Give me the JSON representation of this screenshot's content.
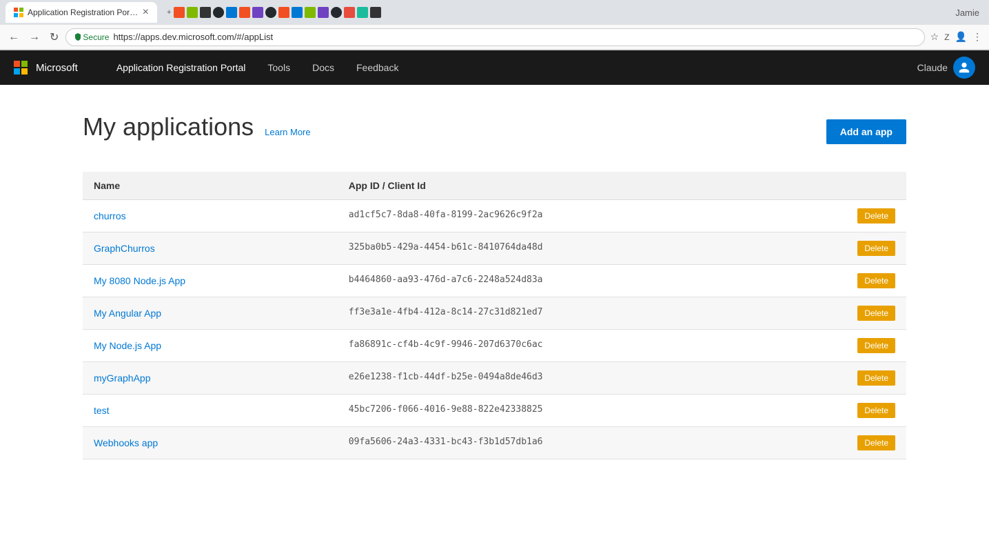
{
  "browser": {
    "tab": {
      "title": "Application Registration Portal",
      "close_icon": "×"
    },
    "address": {
      "secure_label": "Secure",
      "url": "https://apps.dev.microsoft.com/#/appList"
    },
    "user": "Jamie"
  },
  "header": {
    "brand": "Microsoft",
    "portal_title": "Application Registration Portal",
    "nav_items": [
      {
        "label": "Tools"
      },
      {
        "label": "Docs"
      },
      {
        "label": "Feedback"
      }
    ],
    "user_name": "Claude"
  },
  "page": {
    "title": "My applications",
    "learn_more_label": "Learn More",
    "add_button_label": "Add an app"
  },
  "table": {
    "columns": [
      {
        "label": "Name"
      },
      {
        "label": "App ID / Client Id"
      }
    ],
    "rows": [
      {
        "name": "churros",
        "app_id": "ad1cf5c7-8da8-40fa-8199-2ac9626c9f2a",
        "delete_label": "Delete"
      },
      {
        "name": "GraphChurros",
        "app_id": "325ba0b5-429a-4454-b61c-8410764da48d",
        "delete_label": "Delete"
      },
      {
        "name": "My 8080 Node.js App",
        "app_id": "b4464860-aa93-476d-a7c6-2248a524d83a",
        "delete_label": "Delete"
      },
      {
        "name": "My Angular App",
        "app_id": "ff3e3a1e-4fb4-412a-8c14-27c31d821ed7",
        "delete_label": "Delete"
      },
      {
        "name": "My Node.js App",
        "app_id": "fa86891c-cf4b-4c9f-9946-207d6370c6ac",
        "delete_label": "Delete"
      },
      {
        "name": "myGraphApp",
        "app_id": "e26e1238-f1cb-44df-b25e-0494a8de46d3",
        "delete_label": "Delete"
      },
      {
        "name": "test",
        "app_id": "45bc7206-f066-4016-9e88-822e42338825",
        "delete_label": "Delete"
      },
      {
        "name": "Webhooks app",
        "app_id": "09fa5606-24a3-4331-bc43-f3b1d57db1a6",
        "delete_label": "Delete"
      }
    ]
  },
  "colors": {
    "ms_red": "#f25022",
    "ms_green": "#7fba00",
    "ms_blue": "#00a4ef",
    "ms_yellow": "#ffb900",
    "accent": "#0078d4",
    "delete_btn": "#e8a000",
    "header_bg": "#1a1a1a"
  }
}
